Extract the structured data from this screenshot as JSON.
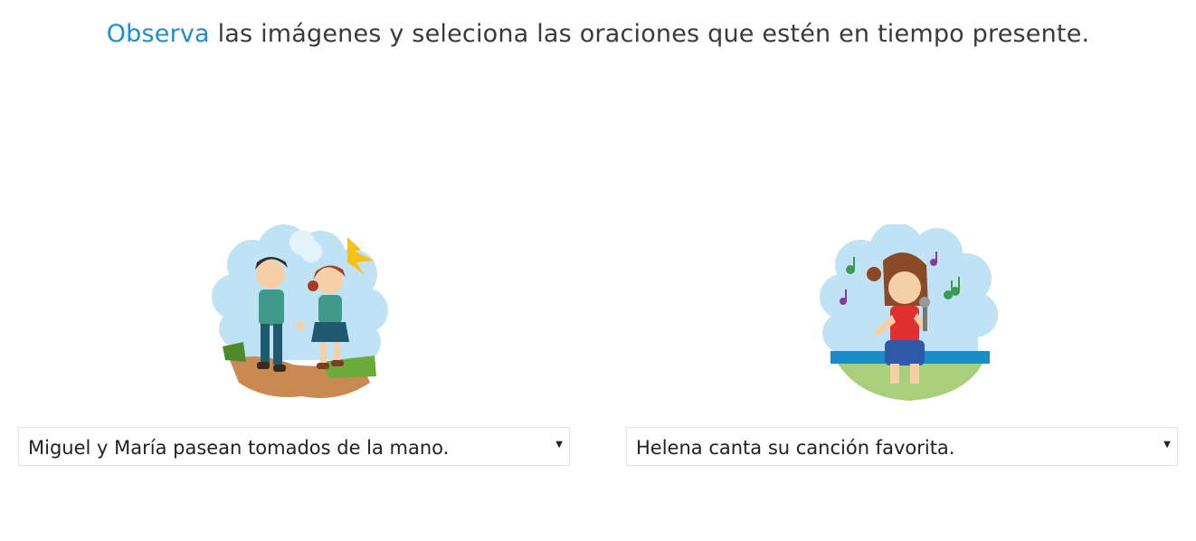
{
  "instruction": {
    "highlight": "Observa",
    "rest": " las imágenes y seleciona las oraciones que estén en tiempo presente."
  },
  "colors": {
    "highlight": "#1b8fcf",
    "text": "#3a3a3a"
  },
  "items": [
    {
      "illustration": "children-walking-holding-hands-illustration",
      "selected_option": "Miguel y María pasean tomados de la mano."
    },
    {
      "illustration": "girl-singing-with-microphone-illustration",
      "selected_option": "Helena canta su canción favorita."
    }
  ],
  "icons": {
    "dropdown": "dropdown-arrow-icon"
  }
}
